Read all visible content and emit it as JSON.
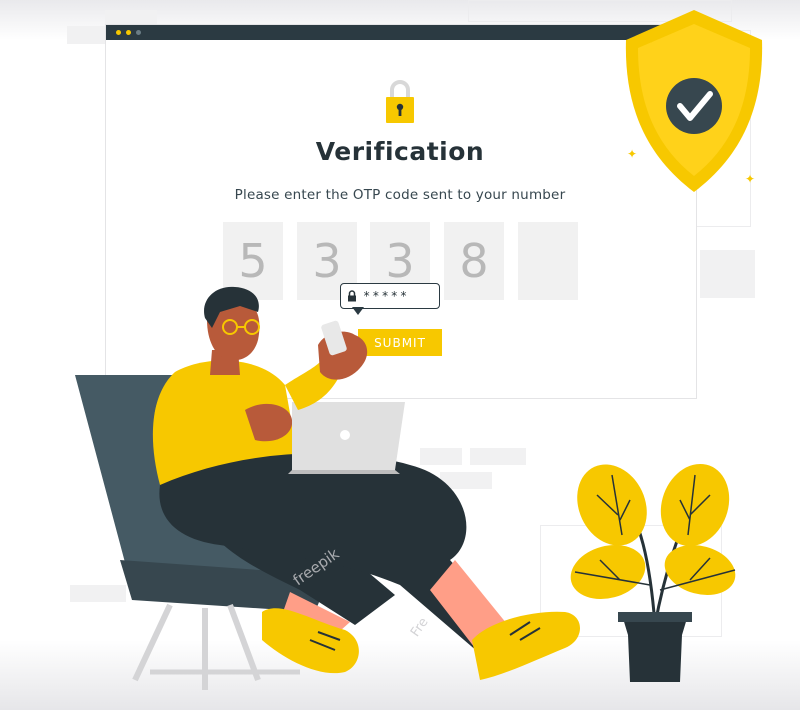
{
  "verification": {
    "title": "Verification",
    "subtitle": "Please enter the OTP code sent to your number",
    "otp_digits": [
      "5",
      "3",
      "3",
      "8",
      ""
    ],
    "submit_label": "SUBMIT",
    "password_mask": "*****"
  },
  "watermark": {
    "text": "freepik",
    "text2": "Fre"
  },
  "colors": {
    "accent": "#f7c800",
    "dark": "#263238",
    "shield": "#f7c800",
    "teal": "#455a64"
  },
  "icons": [
    "lock-icon",
    "shield-check-icon",
    "padlock-mini-icon",
    "checkmark-icon"
  ]
}
